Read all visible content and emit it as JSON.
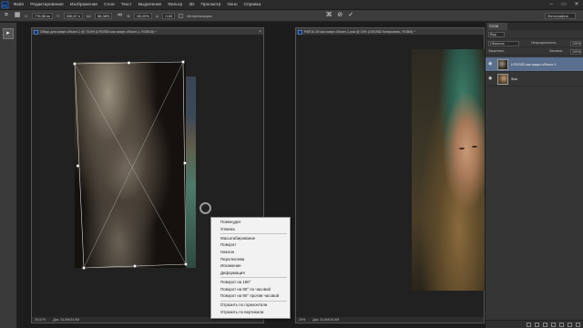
{
  "menubar": {
    "items": [
      "Файл",
      "Редактирование",
      "Изображение",
      "Слои",
      "Текст",
      "Выделение",
      "Фильтр",
      "3D",
      "Просмотр",
      "Окно",
      "Справка"
    ]
  },
  "options": {
    "x_value": "776,56 пк",
    "y_value": "530,67 п",
    "w_value": "58,38%",
    "h_value": "98,20%",
    "angle_value": "0,00",
    "interpolation_label": "Интерполяция:",
    "workspace": "Фотография"
  },
  "doc_left": {
    "title": "Обзор для смарт-объект-1 @ 78,6% (LFIDS83 как смарт-объект-1, RGB/16) *",
    "zoom": "29,57%",
    "doc_info": "Док: 34,9M/34,9M"
  },
  "doc_right": {
    "title": "PAR10-39 как смарт-объект-1.psd @ 15% (1001982 Копировать, RGB/8) *",
    "zoom": "29%",
    "doc_info": "Док: 34,9M/34,9M"
  },
  "context_menu": {
    "group1": [
      "Поменудит",
      "Отмена"
    ],
    "group2": [
      "Масштабирование",
      "Поворот",
      "Наклон",
      "Перспектива",
      "Искажение",
      "Деформация"
    ],
    "group3": [
      "Поворот на 180°",
      "Поворот на 90° по часовой",
      "Поворот на 90° против часовой"
    ],
    "group4": [
      "Отразить по горизонтали",
      "Отразить по вертикали"
    ]
  },
  "layers_panel": {
    "tab": "Слои",
    "filter": "Вид",
    "blend_mode": "Обычные",
    "opacity_label": "Непрозрачность:",
    "opacity": "100%",
    "lock_label": "Закрепить:",
    "fill_label": "Заливка:",
    "fill": "100%",
    "layers": [
      {
        "name": "LFIDS83 как смарт-объект-1",
        "active": true
      },
      {
        "name": "Фон",
        "active": false
      }
    ]
  },
  "colors": {
    "ui_bg": "#1e1e1e",
    "panel": "#353535",
    "selected_layer": "#5a6f8e",
    "menu_bg": "#f2f2f2"
  }
}
